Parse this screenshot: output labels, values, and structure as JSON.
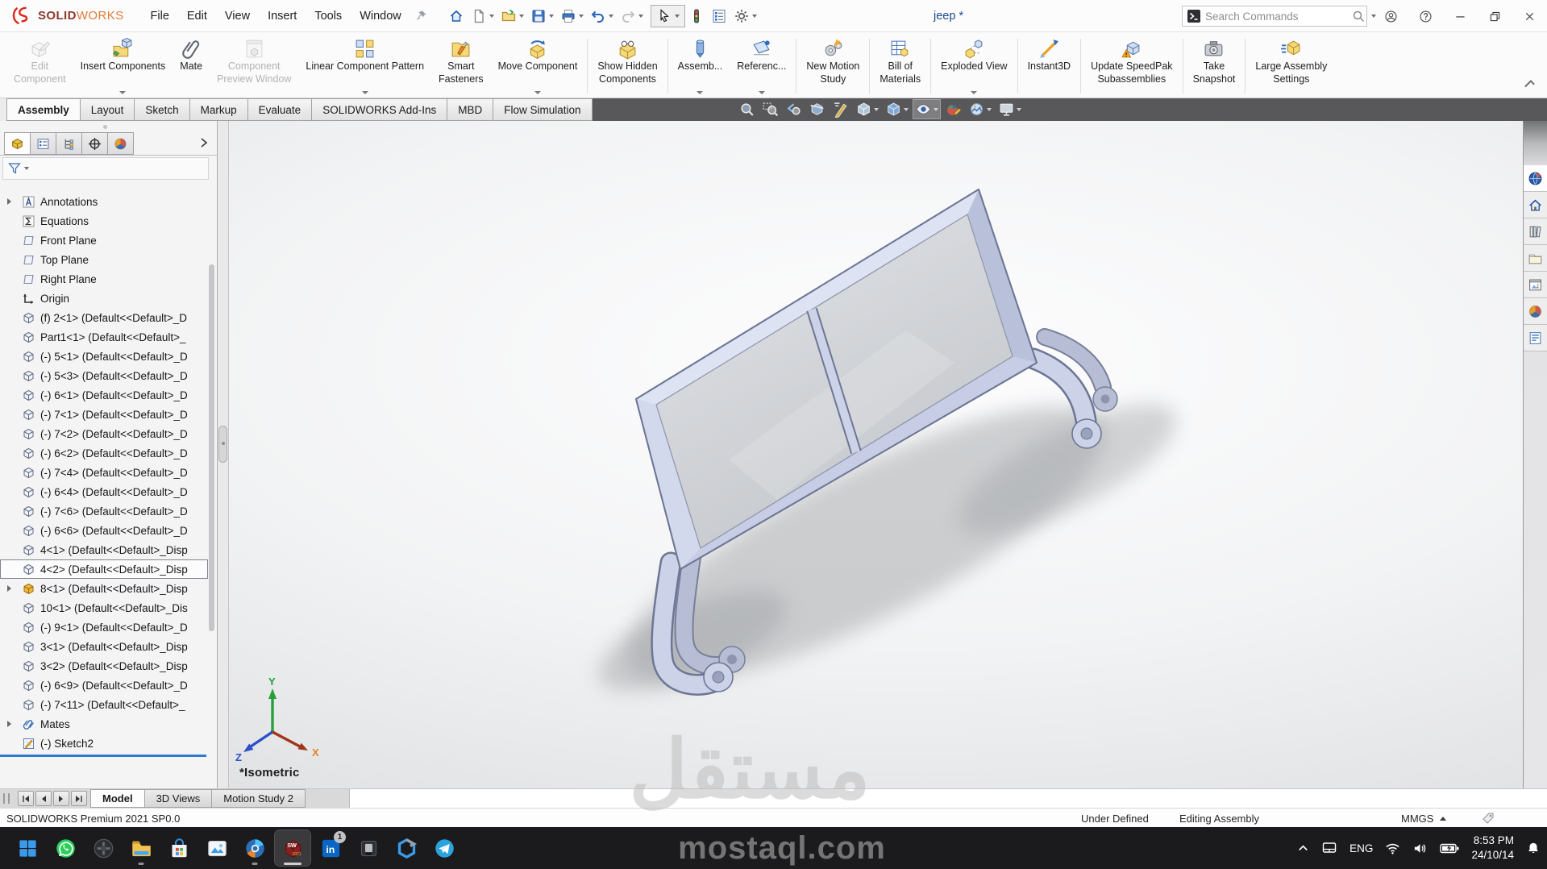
{
  "titlebar": {
    "logo_prefix": "SOLID",
    "logo_suffix": "WORKS",
    "menus": [
      "File",
      "Edit",
      "View",
      "Insert",
      "Tools",
      "Window"
    ],
    "document_title": "jeep *",
    "search": {
      "placeholder": "Search Commands"
    }
  },
  "quick_access": [
    {
      "name": "home",
      "icon": "qa-home"
    },
    {
      "name": "new-document",
      "icon": "qa-new",
      "dropdown": true
    },
    {
      "name": "open",
      "icon": "qa-open",
      "dropdown": true
    },
    {
      "name": "save",
      "icon": "qa-save",
      "dropdown": true
    },
    {
      "name": "print",
      "icon": "qa-print",
      "dropdown": true
    },
    {
      "name": "undo",
      "icon": "qa-undo",
      "dropdown": true
    },
    {
      "name": "redo",
      "icon": "qa-redo",
      "dropdown": true,
      "disabled": true
    },
    {
      "name": "select",
      "icon": "qa-select",
      "dropdown": true,
      "boxed": true
    },
    {
      "name": "rebuild",
      "icon": "qa-rebuild"
    },
    {
      "name": "file-properties",
      "icon": "qa-properties"
    },
    {
      "name": "options",
      "icon": "qa-options",
      "dropdown": true
    }
  ],
  "ribbon": {
    "items": [
      {
        "label": "Edit\nComponent",
        "icon": "ri-edit-component",
        "disabled": true
      },
      {
        "label": "Insert Components",
        "icon": "ri-insert-components",
        "dropdown": true
      },
      {
        "label": "Mate",
        "icon": "ri-mate"
      },
      {
        "label": "Component\nPreview Window",
        "icon": "ri-component-preview",
        "disabled": true
      },
      {
        "label": "Linear Component Pattern",
        "icon": "ri-linear-pattern",
        "dropdown": true
      },
      {
        "label": "Smart\nFasteners",
        "icon": "ri-smart-fasteners"
      },
      {
        "label": "Move Component",
        "icon": "ri-move-component",
        "dropdown": true,
        "sep": true
      },
      {
        "label": "Show Hidden\nComponents",
        "icon": "ri-show-hidden",
        "sep": true
      },
      {
        "label": "Assemb...",
        "icon": "ri-assembly-features",
        "dropdown": true
      },
      {
        "label": "Referenc...",
        "icon": "ri-reference-geometry",
        "dropdown": true,
        "sep": true
      },
      {
        "label": "New Motion\nStudy",
        "icon": "ri-motion-study",
        "sep": true
      },
      {
        "label": "Bill of\nMaterials",
        "icon": "ri-bom",
        "sep": true
      },
      {
        "label": "Exploded View",
        "icon": "ri-exploded-view",
        "dropdown": true,
        "sep": true
      },
      {
        "label": "Instant3D",
        "icon": "ri-instant3d",
        "sep": true
      },
      {
        "label": "Update SpeedPak\nSubassemblies",
        "icon": "ri-speedpak",
        "sep": true
      },
      {
        "label": "Take\nSnapshot",
        "icon": "ri-snapshot",
        "sep": true
      },
      {
        "label": "Large Assembly\nSettings",
        "icon": "ri-large-assembly"
      }
    ]
  },
  "command_tabs": {
    "active_index": 0,
    "tabs": [
      "Assembly",
      "Layout",
      "Sketch",
      "Markup",
      "Evaluate",
      "SOLIDWORKS Add-Ins",
      "MBD",
      "Flow Simulation"
    ]
  },
  "headsup": [
    {
      "name": "zoom-to-fit",
      "icon": "hu-zoom-fit"
    },
    {
      "name": "zoom-to-area",
      "icon": "hu-zoom-area"
    },
    {
      "name": "previous-view",
      "icon": "hu-prev-view"
    },
    {
      "name": "section-view",
      "icon": "hu-section"
    },
    {
      "name": "dynamic-annotation-views",
      "icon": "hu-annotations"
    },
    {
      "name": "view-orientation",
      "icon": "hu-orientation",
      "dropdown": true
    },
    {
      "name": "display-style",
      "icon": "hu-display-style",
      "dropdown": true
    },
    {
      "name": "hide-show-items",
      "icon": "hu-hide-show",
      "dropdown": true,
      "boxed": true
    },
    {
      "name": "edit-appearance",
      "icon": "hu-appearance"
    },
    {
      "name": "apply-scene",
      "icon": "hu-scene",
      "dropdown": true
    },
    {
      "name": "view-settings",
      "icon": "hu-view-settings",
      "dropdown": true
    }
  ],
  "feature_panel": {
    "manager_tabs": [
      {
        "name": "featuremanager-design-tree",
        "icon": "pm-feature",
        "active": true
      },
      {
        "name": "propertymanager",
        "icon": "pm-property"
      },
      {
        "name": "configurationmanager",
        "icon": "pm-config"
      },
      {
        "name": "dimxpertmanager",
        "icon": "pm-dimxpert"
      },
      {
        "name": "displaymanager",
        "icon": "pm-display"
      }
    ],
    "tree": [
      {
        "label": "Annotations",
        "icon": "t-annotations",
        "arrow": true
      },
      {
        "label": "Equations",
        "icon": "t-equations"
      },
      {
        "label": "Front Plane",
        "icon": "t-plane"
      },
      {
        "label": "Top Plane",
        "icon": "t-plane"
      },
      {
        "label": "Right Plane",
        "icon": "t-plane"
      },
      {
        "label": "Origin",
        "icon": "t-origin"
      },
      {
        "label": "(f) 2<1> (Default<<Default>_D",
        "icon": "t-part"
      },
      {
        "label": "Part1<1> (Default<<Default>_",
        "icon": "t-part"
      },
      {
        "label": "(-) 5<1> (Default<<Default>_D",
        "icon": "t-part"
      },
      {
        "label": "(-) 5<3> (Default<<Default>_D",
        "icon": "t-part"
      },
      {
        "label": "(-) 6<1> (Default<<Default>_D",
        "icon": "t-part"
      },
      {
        "label": "(-) 7<1> (Default<<Default>_D",
        "icon": "t-part"
      },
      {
        "label": "(-) 7<2> (Default<<Default>_D",
        "icon": "t-part"
      },
      {
        "label": "(-) 6<2> (Default<<Default>_D",
        "icon": "t-part"
      },
      {
        "label": "(-) 7<4> (Default<<Default>_D",
        "icon": "t-part"
      },
      {
        "label": "(-) 6<4> (Default<<Default>_D",
        "icon": "t-part"
      },
      {
        "label": "(-) 7<6> (Default<<Default>_D",
        "icon": "t-part"
      },
      {
        "label": "(-) 6<6> (Default<<Default>_D",
        "icon": "t-part"
      },
      {
        "label": "4<1> (Default<<Default>_Disp",
        "icon": "t-part"
      },
      {
        "label": "4<2> (Default<<Default>_Disp",
        "icon": "t-part",
        "selected": true
      },
      {
        "label": "8<1> (Default<<Default>_Disp",
        "icon": "t-part-orange",
        "arrow": true
      },
      {
        "label": "10<1> (Default<<Default>_Dis",
        "icon": "t-part"
      },
      {
        "label": "(-) 9<1> (Default<<Default>_D",
        "icon": "t-part"
      },
      {
        "label": "3<1> (Default<<Default>_Disp",
        "icon": "t-part"
      },
      {
        "label": "3<2> (Default<<Default>_Disp",
        "icon": "t-part"
      },
      {
        "label": "(-) 6<9> (Default<<Default>_D",
        "icon": "t-part"
      },
      {
        "label": "(-) 7<11> (Default<<Default>_",
        "icon": "t-part"
      },
      {
        "label": "Mates",
        "icon": "t-mates",
        "arrow": true
      },
      {
        "label": "(-) Sketch2",
        "icon": "t-sketch"
      }
    ]
  },
  "viewport": {
    "view_label": "*Isometric",
    "triad": {
      "x": "X",
      "y": "Y",
      "z": "Z"
    }
  },
  "taskpane_tabs": [
    {
      "name": "solidworks-resources",
      "icon": "tp-resources",
      "active": true
    },
    {
      "name": "home",
      "icon": "tp-home"
    },
    {
      "name": "design-library",
      "icon": "tp-library"
    },
    {
      "name": "file-explorer",
      "icon": "tp-explorer"
    },
    {
      "name": "view-palette",
      "icon": "tp-palette"
    },
    {
      "name": "appearances-scenes",
      "icon": "tp-appearance"
    },
    {
      "name": "custom-properties",
      "icon": "tp-props"
    }
  ],
  "bottom_tabs": {
    "active_index": 0,
    "tabs": [
      "Model",
      "3D Views",
      "Motion Study 2"
    ]
  },
  "statusbar": {
    "product": "SOLIDWORKS Premium 2021 SP0.0",
    "definition_status": "Under Defined",
    "mode": "Editing Assembly",
    "units": "MMGS"
  },
  "taskbar": {
    "items": [
      {
        "name": "start",
        "icon": "tb-start"
      },
      {
        "name": "whatsapp",
        "icon": "tb-whatsapp"
      },
      {
        "name": "game",
        "icon": "tb-game"
      },
      {
        "name": "file-explorer",
        "icon": "tb-explorer",
        "running": true
      },
      {
        "name": "microsoft-store",
        "icon": "tb-store"
      },
      {
        "name": "photos",
        "icon": "tb-photos"
      },
      {
        "name": "browser",
        "icon": "tb-browser",
        "running": true
      },
      {
        "name": "solidworks",
        "icon": "tb-solidworks",
        "active": true
      },
      {
        "name": "linkedin",
        "icon": "tb-linkedin",
        "badge": "1"
      },
      {
        "name": "system-monitor",
        "icon": "tb-monitor"
      },
      {
        "name": "microsoft-365",
        "icon": "tb-m365"
      },
      {
        "name": "telegram",
        "icon": "tb-telegram"
      }
    ],
    "tray": {
      "language": "ENG",
      "time": "8:53 PM",
      "date": "24/10/14"
    }
  },
  "watermark": {
    "arabic": "مستقل",
    "latin": "mostaql.com"
  },
  "colors": {
    "accent": "#2f7bd0",
    "frame": "#ccd3e8",
    "taskbar": "#1b1b1d",
    "logo_red": "#d9261c"
  }
}
